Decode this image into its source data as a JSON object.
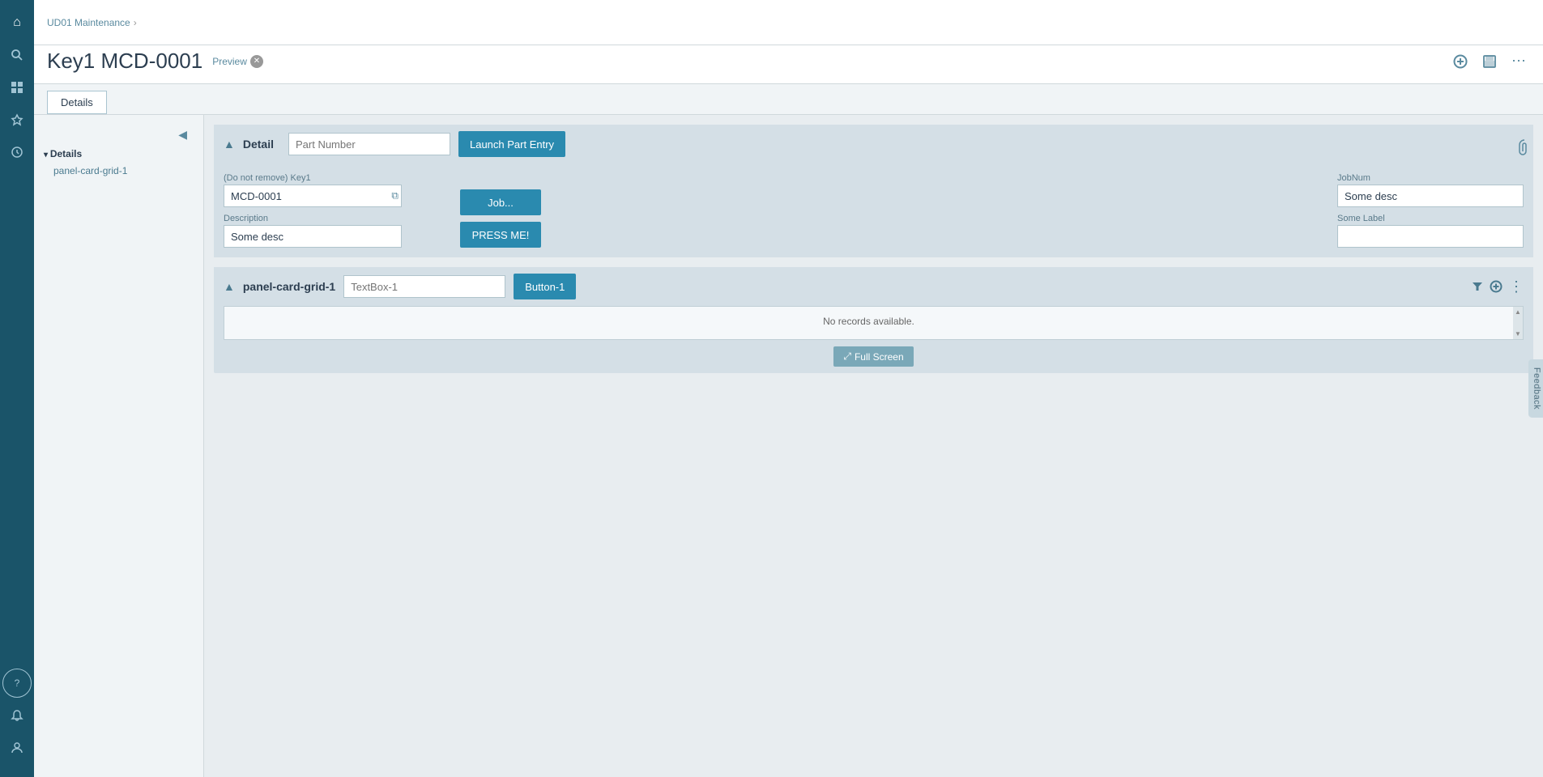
{
  "sidebar": {
    "icons": [
      {
        "name": "home-icon",
        "symbol": "⌂",
        "active": false
      },
      {
        "name": "search-icon",
        "symbol": "🔍",
        "active": false
      },
      {
        "name": "grid-icon",
        "symbol": "⊞",
        "active": false
      },
      {
        "name": "star-icon",
        "symbol": "☆",
        "active": false
      },
      {
        "name": "history-icon",
        "symbol": "⏱",
        "active": false
      }
    ],
    "bottom_icons": [
      {
        "name": "help-icon",
        "symbol": "?"
      },
      {
        "name": "notification-icon",
        "symbol": "🔔"
      },
      {
        "name": "user-icon",
        "symbol": "👤"
      }
    ]
  },
  "breadcrumb": {
    "parent": "UD01 Maintenance",
    "separator": "›"
  },
  "header": {
    "title": "Key1 MCD-0001",
    "preview_label": "Preview",
    "add_icon": "+",
    "save_icon": "💾",
    "more_icon": "⋯",
    "attachment_icon": "📎"
  },
  "tabs": [
    {
      "label": "Details",
      "active": true
    }
  ],
  "nav_panel": {
    "collapse_icon": "◀",
    "section_label": "Details",
    "items": [
      {
        "label": "panel-card-grid-1"
      }
    ]
  },
  "detail_card": {
    "collapse_icon": "▲",
    "title": "Detail",
    "part_number_placeholder": "Part Number",
    "launch_button_label": "Launch Part Entry",
    "key1_label": "(Do not remove) Key1",
    "key1_value": "MCD-0001",
    "copy_icon": "⧉",
    "description_label": "Description",
    "description_value": "Some desc",
    "job_button_label": "Job...",
    "press_button_label": "PRESS ME!",
    "jobnum_label": "JobNum",
    "jobnum_value": "Some desc",
    "some_label": "Some Label",
    "some_label_value": ""
  },
  "grid_card": {
    "collapse_icon": "▲",
    "title": "panel-card-grid-1",
    "textbox_placeholder": "TextBox-1",
    "button_label": "Button-1",
    "filter_icon": "▼",
    "add_icon": "⊕",
    "more_icon": "⋮",
    "no_records_text": "No records available.",
    "fullscreen_label": "Full Screen",
    "fullscreen_icon": "⤢"
  },
  "feedback": {
    "label": "Feedback"
  }
}
